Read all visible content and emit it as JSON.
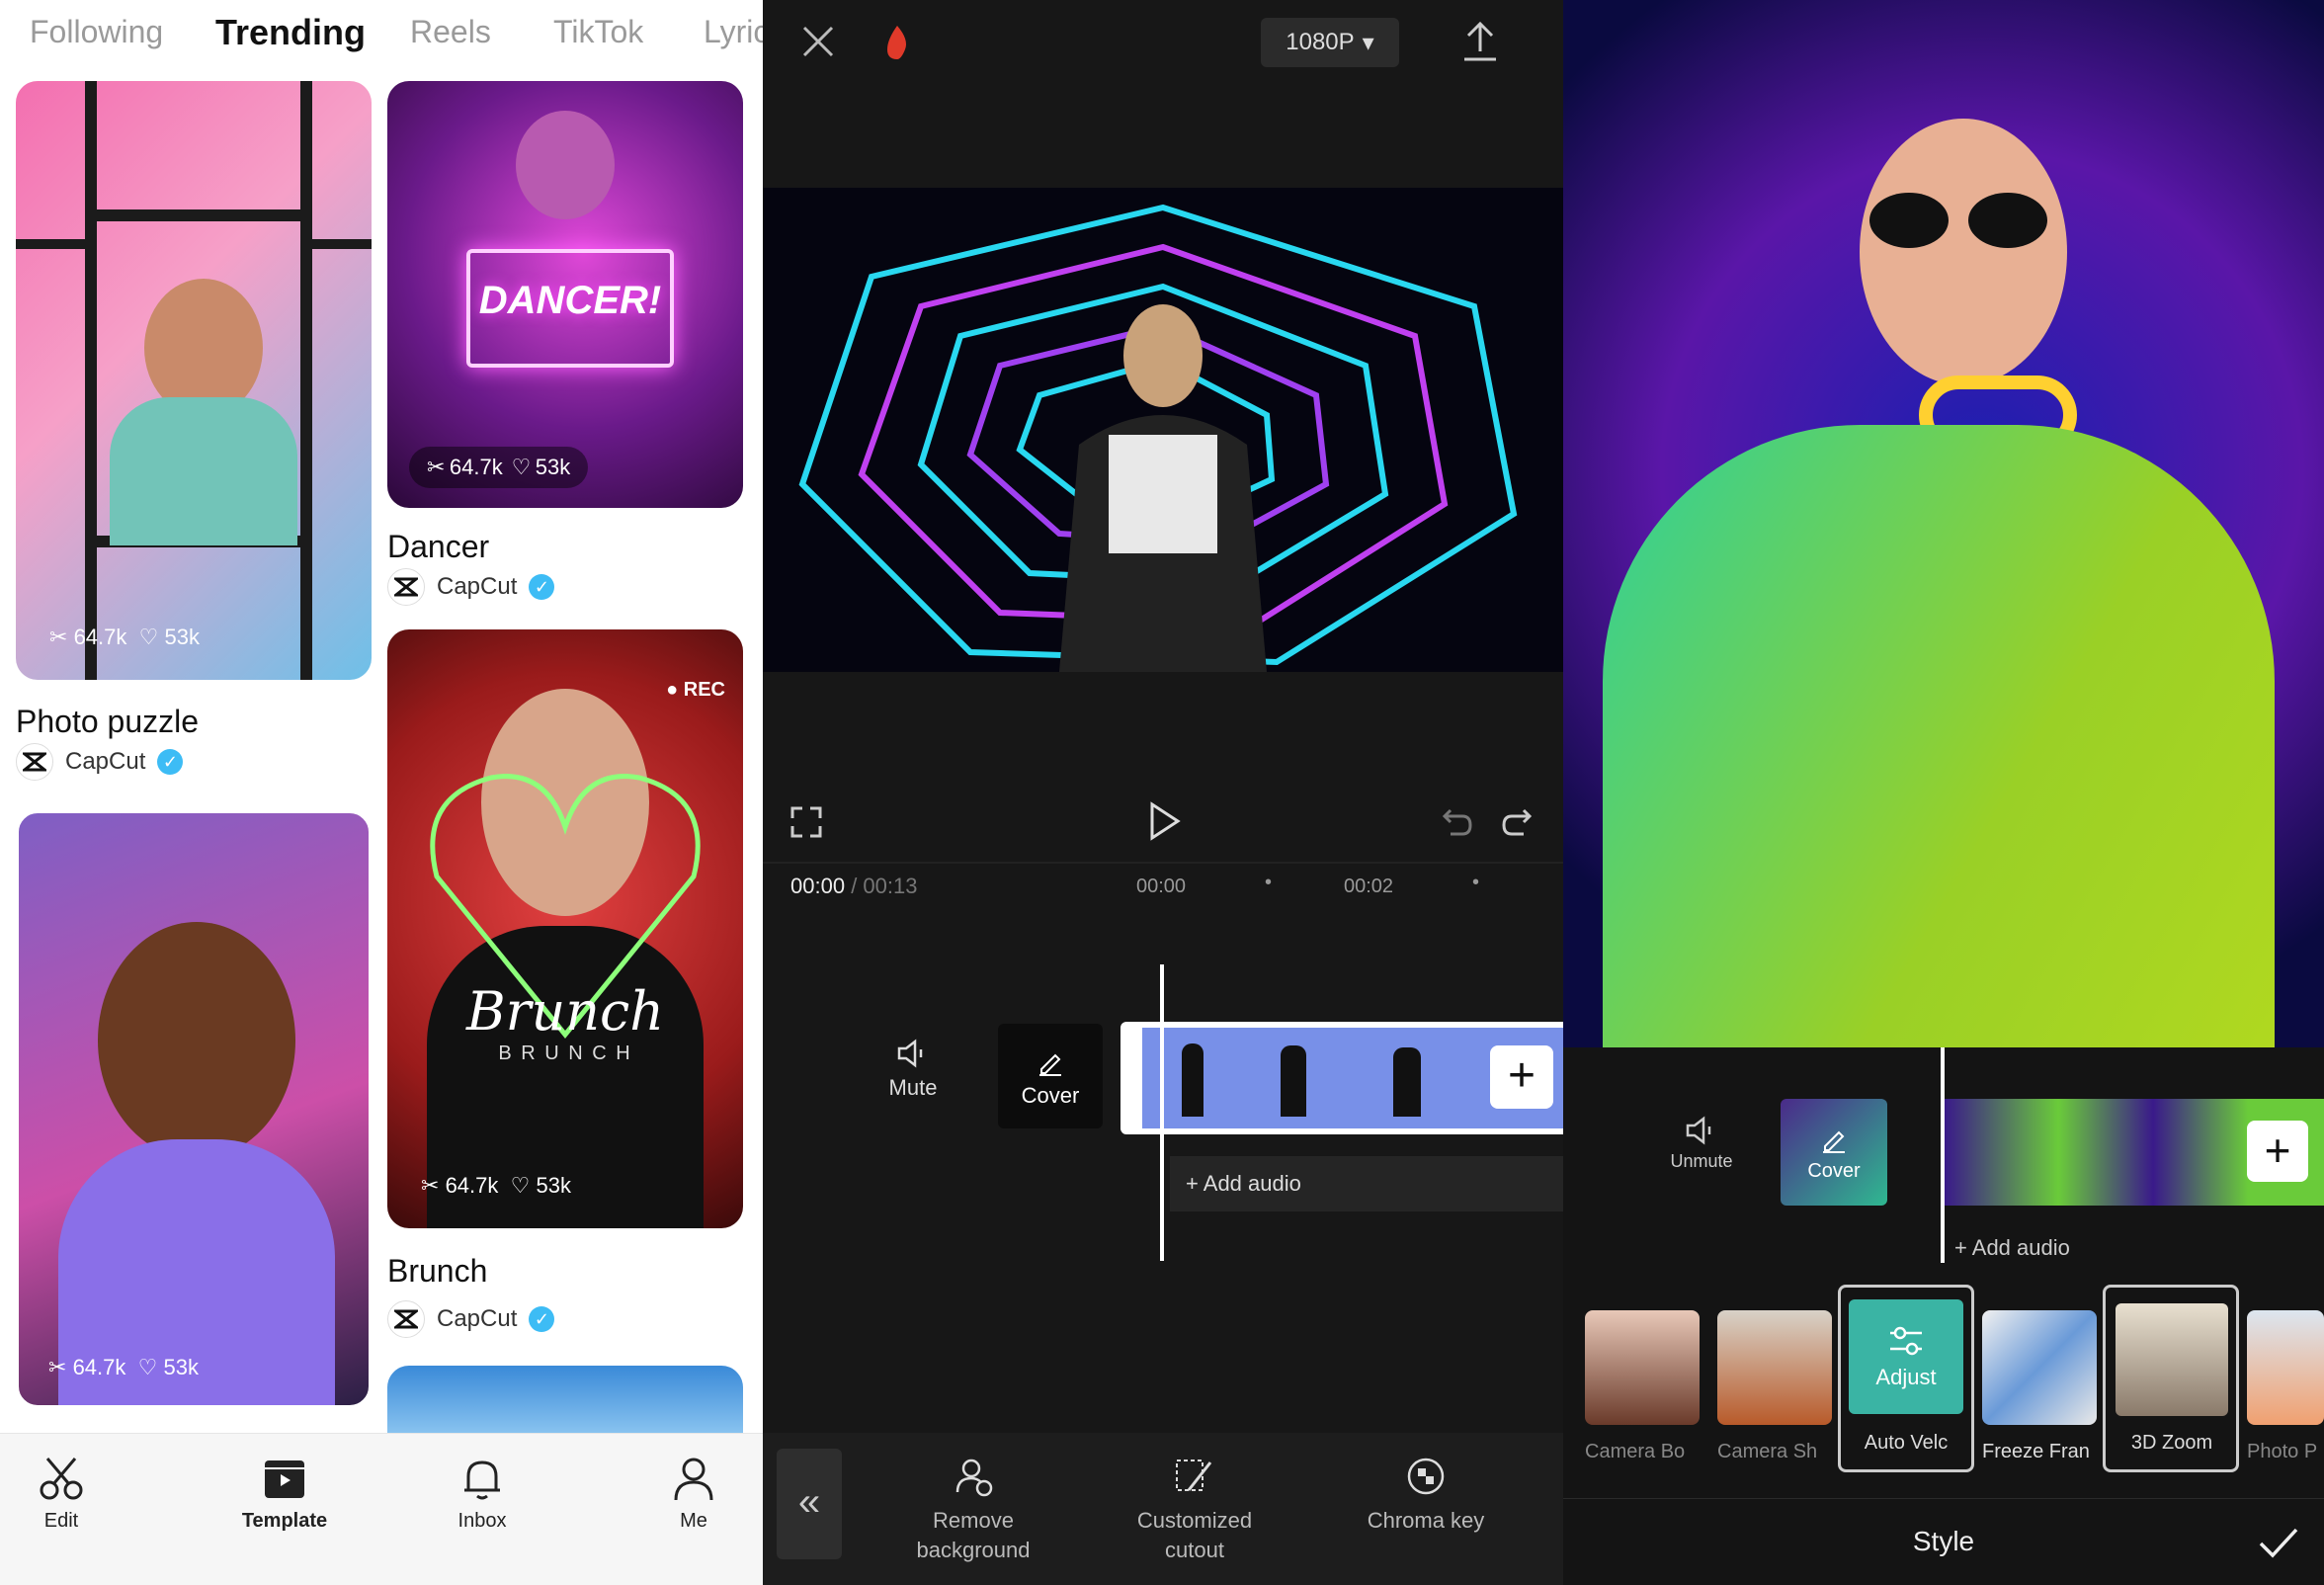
{
  "feed": {
    "tabs": [
      "Following",
      "Trending",
      "Reels",
      "TikTok",
      "Lyric"
    ],
    "active_tab": "Trending",
    "cards": [
      {
        "title": "Photo puzzle",
        "author": "CapCut",
        "uses": "64.7k",
        "likes": "53k"
      },
      {
        "title": "Dancer",
        "author": "CapCut",
        "uses": "64.7k",
        "likes": "53k",
        "banner": "DANCER!"
      },
      {
        "title": "Brunch",
        "author": "CapCut",
        "uses": "64.7k",
        "likes": "53k",
        "overlay": "Brunch",
        "overlay_sub": "B R U N C H",
        "rec": "● REC"
      },
      {
        "uses": "64.7k",
        "likes": "53k"
      }
    ],
    "nav": [
      "Edit",
      "Template",
      "Inbox",
      "Me"
    ]
  },
  "editor": {
    "resolution": "1080P",
    "time_current": "00:00",
    "time_total": "/ 00:13",
    "ruler": [
      "00:00",
      "00:02"
    ],
    "mute_label": "Mute",
    "cover_label": "Cover",
    "add_audio": "Add audio",
    "tools": [
      {
        "label": "Remove background"
      },
      {
        "label": "Customized cutout"
      },
      {
        "label": "Chroma key"
      }
    ]
  },
  "style_panel": {
    "unmute_label": "Unmute",
    "cover_label": "Cover",
    "add_audio": "Add audio",
    "effects": [
      "Camera Bo",
      "Camera Sh",
      "Auto Velc",
      "Freeze Fran",
      "3D Zoom",
      "Photo P"
    ],
    "adjust_label": "Adjust",
    "title": "Style"
  },
  "colors": {
    "accent": "#3dbcf5",
    "editor_bg": "#171717",
    "clip_blue": "#7890e8"
  }
}
